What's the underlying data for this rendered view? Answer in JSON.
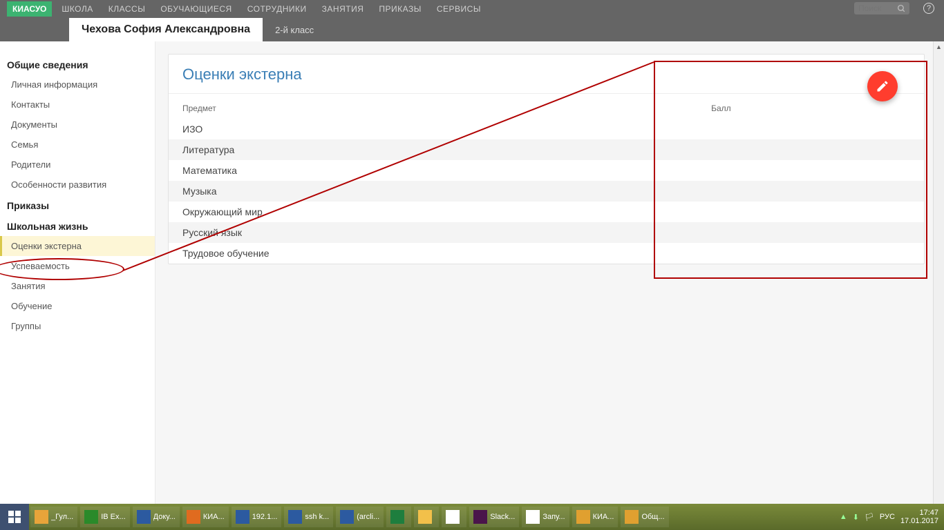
{
  "topnav": {
    "logo": "КИАСУО",
    "items": [
      "ШКОЛА",
      "КЛАССЫ",
      "ОБУЧАЮЩИЕСЯ",
      "СОТРУДНИКИ",
      "ЗАНЯТИЯ",
      "ПРИКАЗЫ",
      "СЕРВИСЫ"
    ],
    "search_placeholder": "Поиск",
    "help": "?"
  },
  "subnav": {
    "student_name": "Чехова София Александровна",
    "class": "2-й класс"
  },
  "sidebar": {
    "sections": [
      {
        "title": "Общие сведения",
        "items": [
          "Личная информация",
          "Контакты",
          "Документы",
          "Семья",
          "Родители",
          "Особенности развития"
        ]
      },
      {
        "title": "Приказы",
        "items": []
      },
      {
        "title": "Школьная жизнь",
        "items": [
          "Оценки экстерна",
          "Успеваемость",
          "Занятия",
          "Обучение",
          "Группы"
        ]
      }
    ],
    "active": "Оценки экстерна"
  },
  "panel": {
    "title": "Оценки экстерна",
    "columns": [
      "Предмет",
      "Балл"
    ],
    "rows": [
      {
        "subject": "ИЗО",
        "grade": ""
      },
      {
        "subject": "Литература",
        "grade": ""
      },
      {
        "subject": "Математика",
        "grade": ""
      },
      {
        "subject": "Музыка",
        "grade": ""
      },
      {
        "subject": "Окружающий мир",
        "grade": ""
      },
      {
        "subject": "Русский язык",
        "grade": ""
      },
      {
        "subject": "Трудовое обучение",
        "grade": ""
      }
    ]
  },
  "taskbar": {
    "items": [
      {
        "label": "_Гул...",
        "color": "#e8a43a"
      },
      {
        "label": "IB Ex...",
        "color": "#2a8a2a"
      },
      {
        "label": "Доку...",
        "color": "#2c5aa0"
      },
      {
        "label": "КИА...",
        "color": "#e06b1f"
      },
      {
        "label": "192.1...",
        "color": "#2c5aa0"
      },
      {
        "label": "ssh k...",
        "color": "#2c5aa0"
      },
      {
        "label": "(arcli...",
        "color": "#2c5aa0"
      },
      {
        "label": "",
        "color": "#1e7e3e"
      },
      {
        "label": "",
        "color": "#f2c04a"
      },
      {
        "label": "",
        "color": "#ffffff"
      },
      {
        "label": "Slack...",
        "color": "#4a154b"
      },
      {
        "label": "Запу...",
        "color": "#ffffff"
      },
      {
        "label": "КИА...",
        "color": "#e0a030"
      },
      {
        "label": "Общ...",
        "color": "#e0a030"
      }
    ],
    "lang": "РУС",
    "time": "17:47",
    "date": "17.01.2017"
  }
}
